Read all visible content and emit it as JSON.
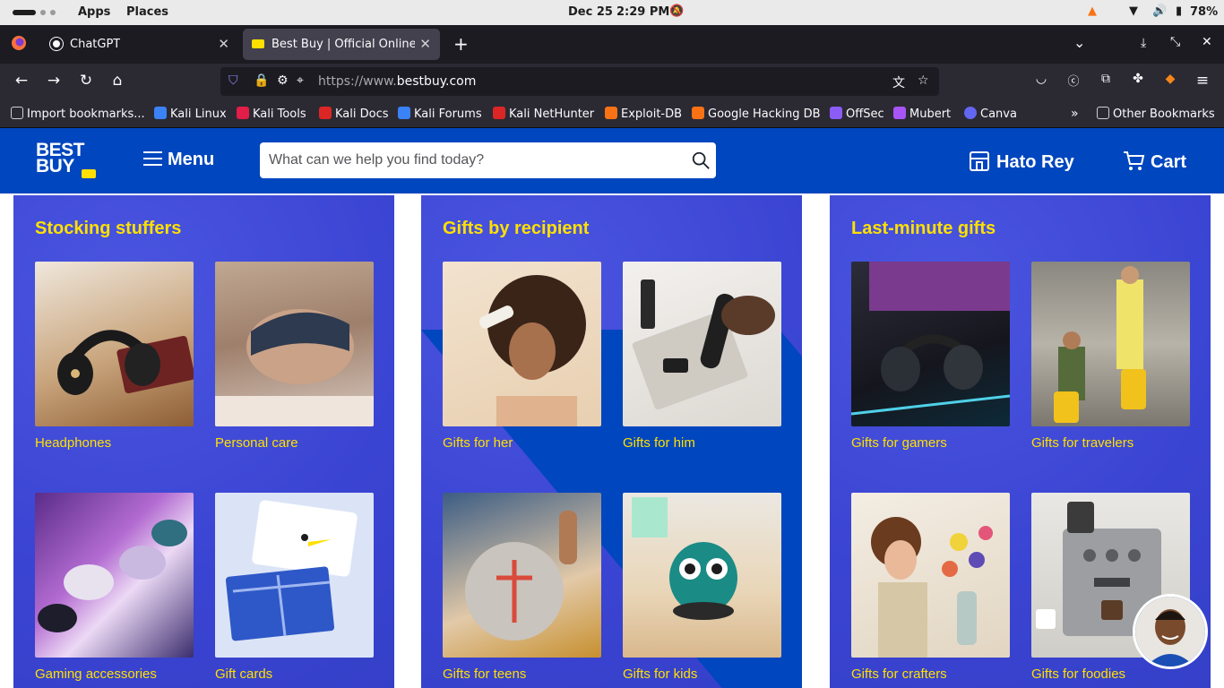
{
  "os_bar": {
    "apps": "Apps",
    "places": "Places",
    "date": "Dec 25",
    "time": "2:29 PM",
    "battery": "78%"
  },
  "tabs": [
    {
      "title": "ChatGPT",
      "active": false
    },
    {
      "title": "Best Buy | Official Online S",
      "active": true
    }
  ],
  "address_bar": {
    "url_prefix": "https://www.",
    "url_domain": "bestbuy.com"
  },
  "bookmarks": [
    {
      "label": "Import bookmarks...",
      "icon": "import-icon",
      "color": "#cfcfd8"
    },
    {
      "label": "Kali Linux",
      "icon": "kali-dragon-icon",
      "color": "#3b82f6"
    },
    {
      "label": "Kali Tools",
      "icon": "kali-tools-icon",
      "color": "#e11d48"
    },
    {
      "label": "Kali Docs",
      "icon": "kali-docs-icon",
      "color": "#dc2626"
    },
    {
      "label": "Kali Forums",
      "icon": "kali-forums-icon",
      "color": "#3b82f6"
    },
    {
      "label": "Kali NetHunter",
      "icon": "kali-nethunter-icon",
      "color": "#dc2626"
    },
    {
      "label": "Exploit-DB",
      "icon": "exploit-db-icon",
      "color": "#f97316"
    },
    {
      "label": "Google Hacking DB",
      "icon": "ghdb-icon",
      "color": "#f97316"
    },
    {
      "label": "OffSec",
      "icon": "offsec-icon",
      "color": "#8b5cf6"
    },
    {
      "label": "Mubert",
      "icon": "mubert-icon",
      "color": "#a855f7"
    },
    {
      "label": "Canva",
      "icon": "canva-icon",
      "color": "#6366f1"
    },
    {
      "label": "Other Bookmarks",
      "icon": "folder-icon",
      "color": "#cfcfd8"
    }
  ],
  "header": {
    "logo_line1": "BEST",
    "logo_line2": "BUY",
    "menu": "Menu",
    "search_placeholder": "What can we help you find today?",
    "store": "Hato Rey",
    "cart": "Cart"
  },
  "sections": [
    {
      "title": "Stocking stuffers",
      "items": [
        "Headphones",
        "Personal care",
        "Gaming accessories",
        "Gift cards"
      ]
    },
    {
      "title": "Gifts by recipient",
      "items": [
        "Gifts for her",
        "Gifts for him",
        "Gifts for teens",
        "Gifts for kids"
      ]
    },
    {
      "title": "Last-minute gifts",
      "items": [
        "Gifts for gamers",
        "Gifts for travelers",
        "Gifts for crafters",
        "Gifts for foodies"
      ]
    }
  ],
  "colors": {
    "brand_blue": "#0046be",
    "brand_yellow": "#ffe000",
    "panel_blue": "#3c47d6"
  }
}
